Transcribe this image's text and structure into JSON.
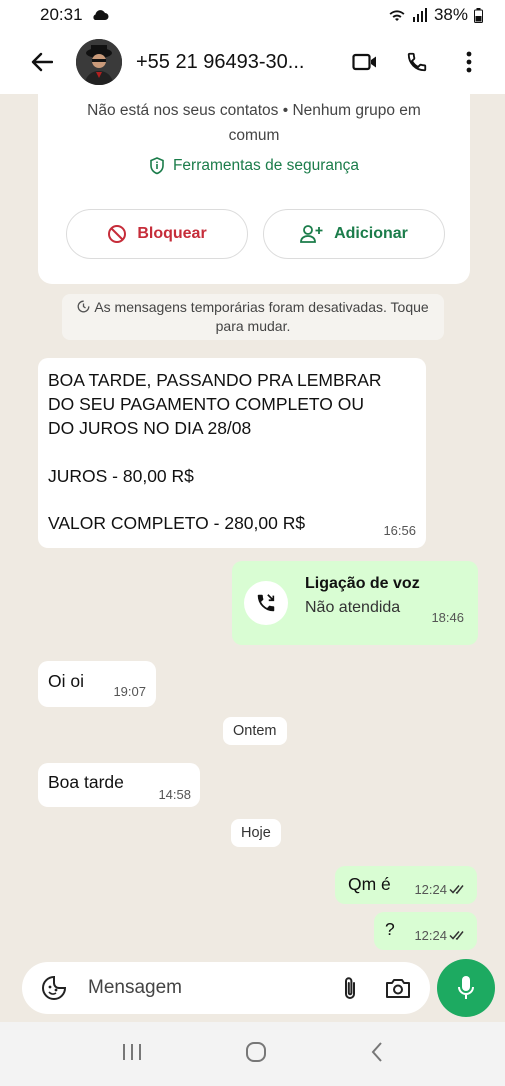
{
  "status_bar": {
    "time": "20:31",
    "battery": "38%"
  },
  "header": {
    "contact": "+55 21 96493-30..."
  },
  "info_card": {
    "text": "Não está nos seus contatos • Nenhum grupo em comum",
    "security_tools": "Ferramentas de segurança",
    "block_label": "Bloquear",
    "add_label": "Adicionar"
  },
  "system_note": "As mensagens temporárias foram desativadas. Toque para mudar.",
  "messages": {
    "m1": {
      "line1": "BOA TARDE, PASSANDO PRA LEMBRAR",
      "line2": "DO SEU PAGAMENTO COMPLETO OU",
      "line3": "DO JUROS NO DIA 28/08",
      "line4": "JUROS - 80,00 R$",
      "line5": "VALOR COMPLETO - 280,00 R$",
      "time": "16:56"
    },
    "call": {
      "title": "Ligação de voz",
      "status": "Não atendida",
      "time": "18:46"
    },
    "m2": {
      "text": "Oi oi",
      "time": "19:07"
    },
    "date1": "Ontem",
    "m3": {
      "text": "Boa tarde",
      "time": "14:58"
    },
    "date2": "Hoje",
    "m4": {
      "text": "Qm é",
      "time": "12:24"
    },
    "m5": {
      "text": "?",
      "time": "12:24"
    }
  },
  "composer": {
    "placeholder": "Mensagem"
  },
  "colors": {
    "accent": "#1daa61",
    "outgoing": "#d9fdd3",
    "block_red": "#c62d3a",
    "green_text": "#1b7c4a"
  },
  "icons": [
    "back-arrow-icon",
    "video-call-icon",
    "phone-icon",
    "more-vert-icon",
    "shield-icon",
    "block-icon",
    "add-person-icon",
    "timer-icon",
    "missed-call-icon",
    "read-ticks-icon",
    "sticker-icon",
    "attach-icon",
    "camera-icon",
    "mic-icon",
    "recents-icon",
    "home-icon",
    "back-nav-icon"
  ]
}
